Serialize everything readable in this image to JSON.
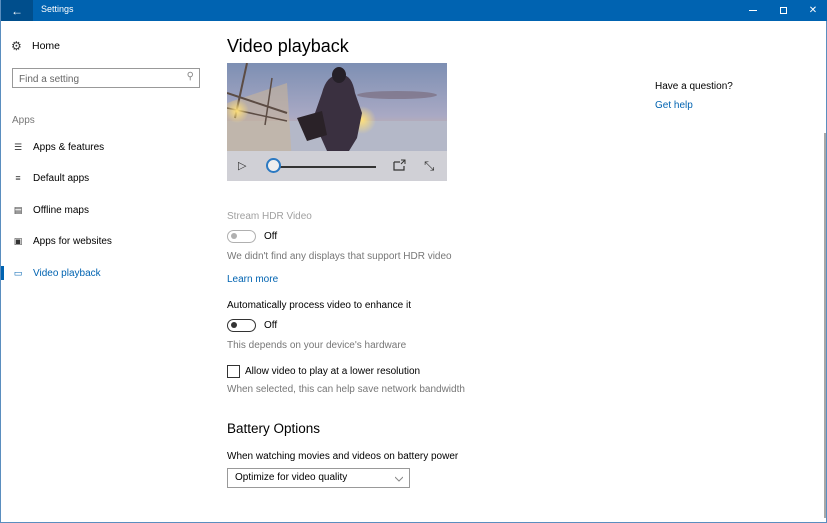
{
  "window": {
    "title": "Settings",
    "back_icon": "arrow-left-icon",
    "controls": {
      "minimize": "minimize-icon",
      "maximize": "maximize-icon",
      "close": "close-icon"
    }
  },
  "sidebar": {
    "home": {
      "icon": "gear-icon",
      "label": "Home"
    },
    "search": {
      "placeholder": "Find a setting",
      "value": "",
      "icon": "search-icon"
    },
    "section_label": "Apps",
    "items": [
      {
        "label": "Apps & features",
        "icon": "list-icon",
        "active": false
      },
      {
        "label": "Default apps",
        "icon": "default-list-icon",
        "active": false
      },
      {
        "label": "Offline maps",
        "icon": "map-download-icon",
        "active": false
      },
      {
        "label": "Apps for websites",
        "icon": "web-app-icon",
        "active": false
      },
      {
        "label": "Video playback",
        "icon": "video-icon",
        "active": true
      }
    ]
  },
  "main": {
    "title": "Video playback",
    "preview": {
      "play_icon": "play-icon",
      "progress_percent": 0,
      "cast_icon": "cast-icon",
      "fullscreen_icon": "fullscreen-icon"
    },
    "hdr": {
      "label": "Stream HDR Video",
      "toggle_state": "Off",
      "enabled": false,
      "on": false,
      "description": "We didn't find any displays that support HDR video",
      "learn_more": "Learn more"
    },
    "auto_process": {
      "label": "Automatically process video to enhance it",
      "toggle_state": "Off",
      "on": false,
      "description": "This depends on your device's hardware"
    },
    "low_resolution": {
      "label": "Allow video to play at a lower resolution",
      "checked": false,
      "description": "When selected, this can help save network bandwidth"
    },
    "battery": {
      "heading": "Battery Options",
      "label": "When watching movies and videos on battery power",
      "selected": "Optimize for video quality"
    }
  },
  "help": {
    "title": "Have a question?",
    "link": "Get help"
  },
  "colors": {
    "accent": "#0063b1",
    "titlebar": "#0063b1",
    "back_button": "#004e8c"
  }
}
